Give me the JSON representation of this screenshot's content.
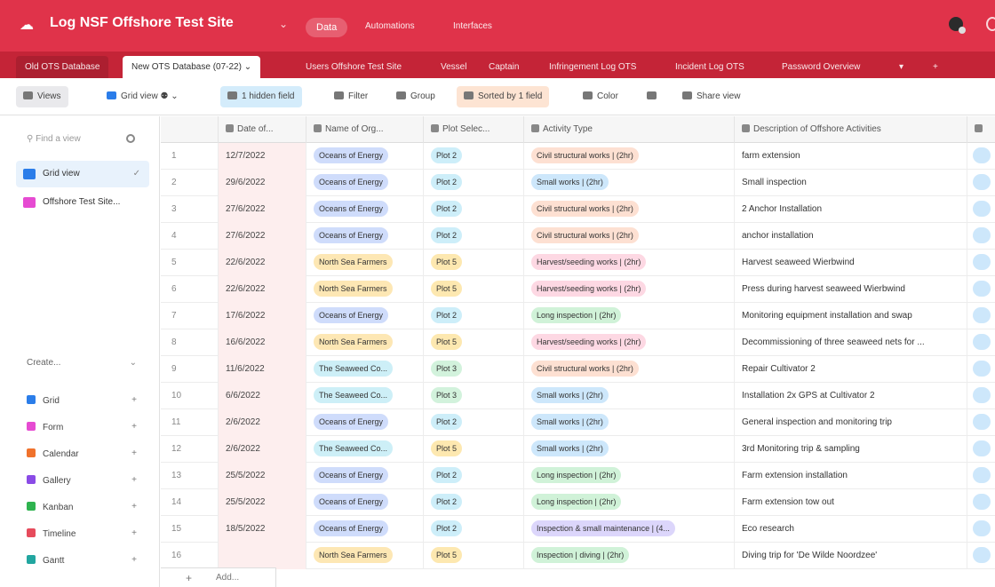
{
  "header": {
    "base_title": "Log NSF Offshore Test Site",
    "chevron": "⌄",
    "nav": [
      "Data",
      "Automations",
      "Interfaces"
    ]
  },
  "tables": [
    "Old OTS Database",
    "New OTS Database (07-22)",
    "Users Offshore Test Site",
    "Vessel",
    "Captain",
    "Infringement Log OTS",
    "Incident Log OTS",
    "Password Overview"
  ],
  "toolbar": {
    "views": "Views",
    "grid_view": "Grid view",
    "hidden_fields": "1 hidden field",
    "filter": "Filter",
    "group": "Group",
    "sorted": "Sorted by 1 field",
    "color": "Color",
    "share": "Share view"
  },
  "sidebar": {
    "find_placeholder": "Find a view",
    "views": [
      {
        "label": "Grid view",
        "color": "#2b7de9"
      },
      {
        "label": "Offshore Test Site...",
        "color": "#e64bd2"
      }
    ],
    "create_label": "Create...",
    "create_types": [
      {
        "label": "Grid",
        "color": "#2b7de9"
      },
      {
        "label": "Form",
        "color": "#e64bd2"
      },
      {
        "label": "Calendar",
        "color": "#f0722c"
      },
      {
        "label": "Gallery",
        "color": "#8a4be6"
      },
      {
        "label": "Kanban",
        "color": "#2fb34f"
      },
      {
        "label": "Timeline",
        "color": "#e64b5c"
      },
      {
        "label": "Gantt",
        "color": "#22a6a0"
      }
    ]
  },
  "columns": [
    "Date of...",
    "Name of Org...",
    "Plot Selec...",
    "Activity Type",
    "Description of Offshore Activities"
  ],
  "rows": [
    {
      "num": "1",
      "date": "12/7/2022",
      "org": "Oceans of Energy",
      "plot": "Plot 2",
      "activity": "Civil structural works | (2hr)",
      "desc": "farm extension"
    },
    {
      "num": "2",
      "date": "29/6/2022",
      "org": "Oceans of Energy",
      "plot": "Plot 2",
      "activity": "Small works | (2hr)",
      "desc": "Small inspection"
    },
    {
      "num": "3",
      "date": "27/6/2022",
      "org": "Oceans of Energy",
      "plot": "Plot 2",
      "activity": "Civil structural works | (2hr)",
      "desc": "2 Anchor Installation"
    },
    {
      "num": "4",
      "date": "27/6/2022",
      "org": "Oceans of Energy",
      "plot": "Plot 2",
      "activity": "Civil structural works | (2hr)",
      "desc": "anchor installation"
    },
    {
      "num": "5",
      "date": "22/6/2022",
      "org": "North Sea Farmers",
      "plot": "Plot 5",
      "activity": "Harvest/seeding works | (2hr)",
      "desc": "Harvest seaweed Wierbwind"
    },
    {
      "num": "6",
      "date": "22/6/2022",
      "org": "North Sea Farmers",
      "plot": "Plot 5",
      "activity": "Harvest/seeding works | (2hr)",
      "desc": "Press during harvest seaweed Wierbwind"
    },
    {
      "num": "7",
      "date": "17/6/2022",
      "org": "Oceans of Energy",
      "plot": "Plot 2",
      "activity": "Long inspection | (2hr)",
      "desc": "Monitoring equipment installation and swap"
    },
    {
      "num": "8",
      "date": "16/6/2022",
      "org": "North Sea Farmers",
      "plot": "Plot 5",
      "activity": "Harvest/seeding works | (2hr)",
      "desc": "Decommissioning of three seaweed nets for ..."
    },
    {
      "num": "9",
      "date": "11/6/2022",
      "org": "The Seaweed Co...",
      "plot": "Plot 3",
      "activity": "Civil structural works | (2hr)",
      "desc": "Repair Cultivator 2"
    },
    {
      "num": "10",
      "date": "6/6/2022",
      "org": "The Seaweed Co...",
      "plot": "Plot 3",
      "activity": "Small works | (2hr)",
      "desc": "Installation 2x GPS at Cultivator 2"
    },
    {
      "num": "11",
      "date": "2/6/2022",
      "org": "Oceans of Energy",
      "plot": "Plot 2",
      "activity": "Small works | (2hr)",
      "desc": "General inspection and monitoring trip"
    },
    {
      "num": "12",
      "date": "2/6/2022",
      "org": "The Seaweed Co...",
      "plot": "Plot 5",
      "activity": "Small works | (2hr)",
      "desc": "3rd Monitoring trip & sampling"
    },
    {
      "num": "13",
      "date": "25/5/2022",
      "org": "Oceans of Energy",
      "plot": "Plot 2",
      "activity": "Long inspection | (2hr)",
      "desc": "Farm extension installation"
    },
    {
      "num": "14",
      "date": "25/5/2022",
      "org": "Oceans of Energy",
      "plot": "Plot 2",
      "activity": "Long inspection | (2hr)",
      "desc": "Farm extension tow out"
    },
    {
      "num": "15",
      "date": "18/5/2022",
      "org": "Oceans of Energy",
      "plot": "Plot 2",
      "activity": "Inspection & small maintenance | (4...",
      "desc": "Eco research"
    },
    {
      "num": "16",
      "date": "",
      "org": "North Sea Farmers",
      "plot": "Plot 5",
      "activity": "Inspection | diving | (2hr)",
      "desc": "Diving trip for 'De Wilde Noordzee'"
    }
  ],
  "add_label": "Add...",
  "pill_colors": {
    "org_blue": "#cfdcfb",
    "org_yellow": "#fde7b4",
    "org_cyan": "#cdeff7",
    "plot_blue": "#cdeef9",
    "plot_yellow": "#fde8b0",
    "plot_green": "#d2f2dc",
    "act_orange": "#fde0d2",
    "act_blue": "#cde7fb",
    "act_pink": "#fdd8e3",
    "act_green": "#d0f2d8",
    "act_purple": "#dcd6fb",
    "edge_blue": "#cde7fb"
  }
}
